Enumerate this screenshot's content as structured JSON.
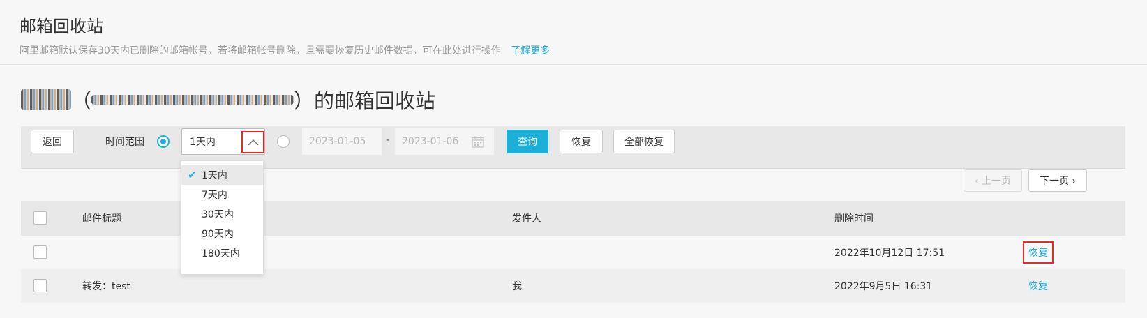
{
  "header": {
    "title": "邮箱回收站",
    "description": "阿里邮箱默认保存30天内已删除的邮箱帐号，若将邮箱帐号删除，且需要恢复历史邮件数据，可在此处进行操作",
    "learn_more": "了解更多"
  },
  "section": {
    "open_paren": "（",
    "close_paren_title": "）的邮箱回收站"
  },
  "toolbar": {
    "back": "返回",
    "time_range_label": "时间范围",
    "selected_range": "1天内",
    "date_start": "2023-01-05",
    "date_separator": "-",
    "date_end": "2023-01-06",
    "query": "查询",
    "restore": "恢复",
    "restore_all": "全部恢复"
  },
  "dropdown": {
    "options": [
      "1天内",
      "7天内",
      "30天内",
      "90天内",
      "180天内"
    ],
    "selected_index": 0
  },
  "pager": {
    "prev": "‹ 上一页",
    "next": "下一页 ›"
  },
  "table": {
    "columns": [
      "邮件标题",
      "发件人",
      "删除时间"
    ],
    "rows": [
      {
        "subject": "",
        "sender": "",
        "deleted_at": "2022年10月12日 17:51",
        "action": "恢复"
      },
      {
        "subject": "转发：test",
        "sender": "我",
        "deleted_at": "2022年9月5日 16:31",
        "action": "恢复"
      }
    ]
  },
  "colors": {
    "accent": "#1cb0d8",
    "highlight": "#e52a2a"
  }
}
